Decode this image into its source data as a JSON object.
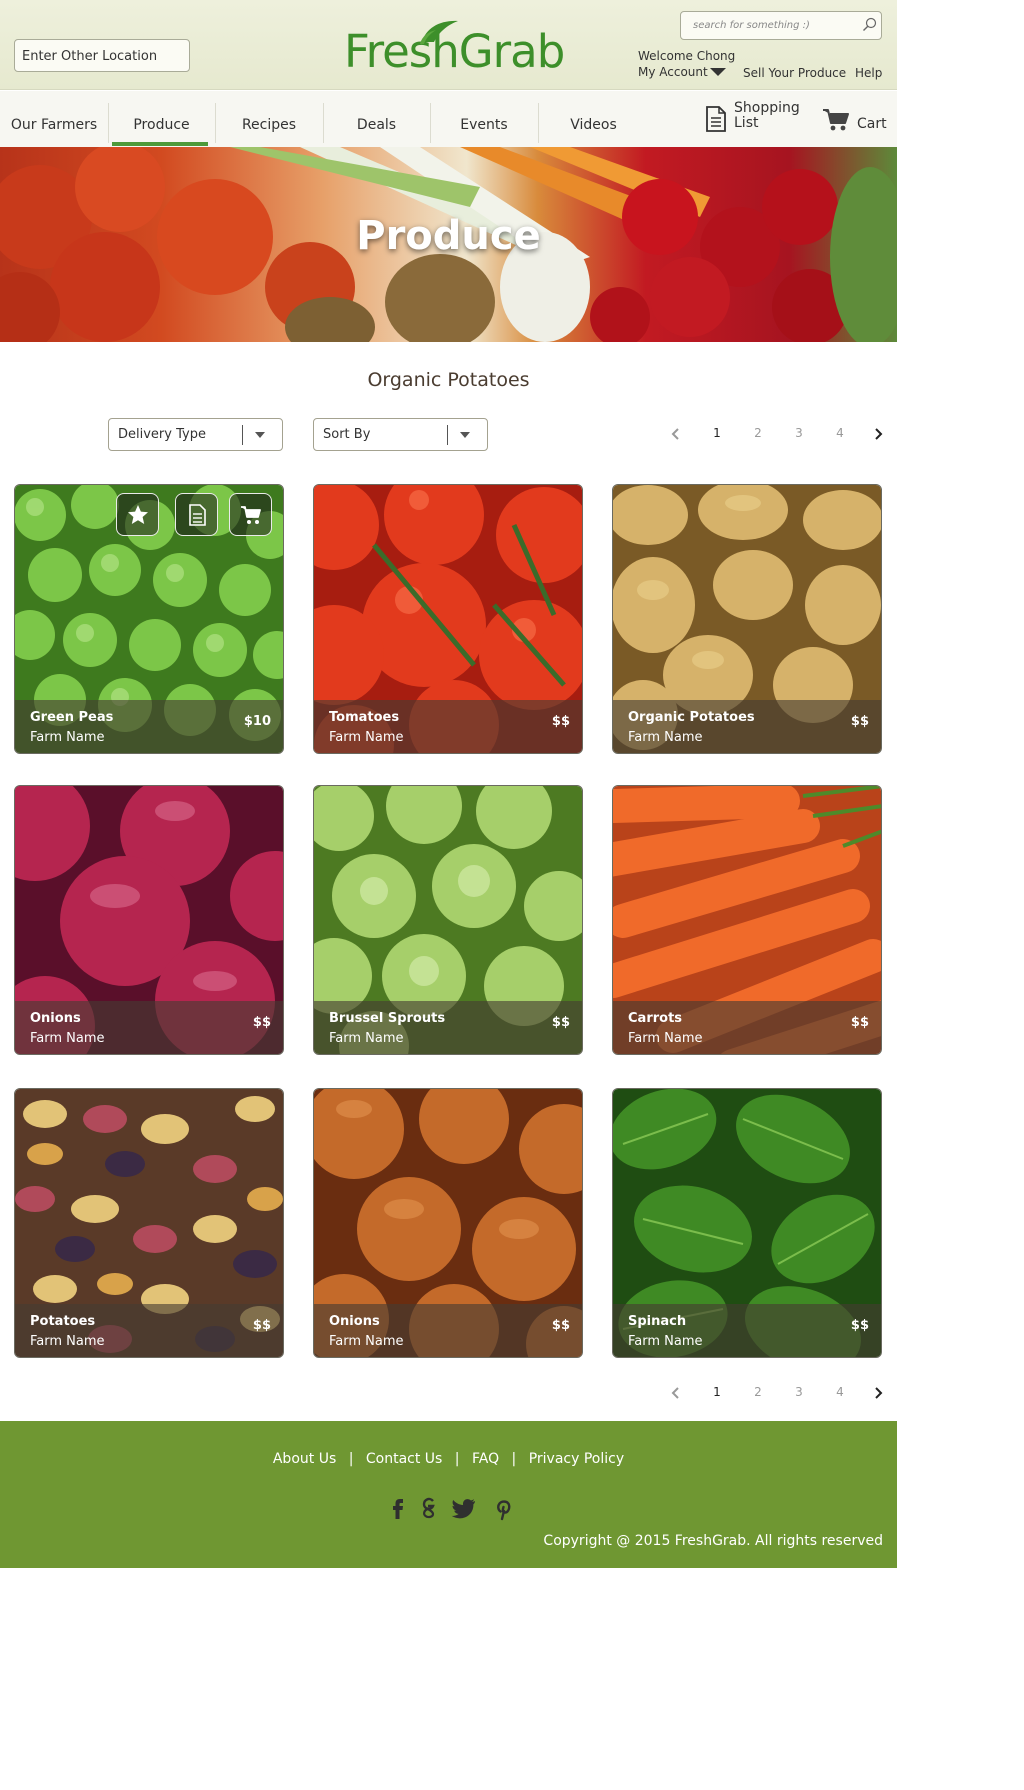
{
  "header": {
    "location_placeholder": "Enter Other Location",
    "logo": "FreshGrab",
    "search_placeholder": "search for something :)",
    "welcome": "Welcome Chong",
    "my_account": "My Account",
    "sell": "Sell Your Produce",
    "help": "Help"
  },
  "nav": {
    "items": [
      "Our Farmers",
      "Produce",
      "Recipes",
      "Deals",
      "Events",
      "Videos"
    ],
    "active": "Produce",
    "shopping_list_line1": "Shopping",
    "shopping_list_line2": "List",
    "cart": "Cart"
  },
  "hero": {
    "title": "Produce"
  },
  "main": {
    "title": "Organic Potatoes",
    "delivery_type": "Delivery Type",
    "sort_by": "Sort By",
    "pages": [
      "1",
      "2",
      "3",
      "4"
    ],
    "current_page": "1"
  },
  "products": [
    {
      "name": "Green Peas",
      "farm": "Farm Name",
      "price": "$10"
    },
    {
      "name": "Tomatoes",
      "farm": "Farm Name",
      "price": "$$"
    },
    {
      "name": "Organic Potatoes",
      "farm": "Farm Name",
      "price": "$$"
    },
    {
      "name": "Onions",
      "farm": "Farm Name",
      "price": "$$"
    },
    {
      "name": "Brussel Sprouts",
      "farm": "Farm Name",
      "price": "$$"
    },
    {
      "name": "Carrots",
      "farm": "Farm Name",
      "price": "$$"
    },
    {
      "name": "Potatoes",
      "farm": "Farm Name",
      "price": "$$"
    },
    {
      "name": "Onions",
      "farm": "Farm Name",
      "price": "$$"
    },
    {
      "name": "Spinach",
      "farm": "Farm Name",
      "price": "$$"
    }
  ],
  "footer": {
    "links": [
      "About Us",
      "Contact Us",
      "FAQ",
      "Privacy Policy"
    ],
    "separator": "|",
    "social": [
      "facebook-icon",
      "google-plus-icon",
      "twitter-icon",
      "pinterest-icon"
    ],
    "copyright": "Copyright @ 2015 FreshGrab. All rights reserved"
  },
  "colors": {
    "brand_green": "#3d8f2a",
    "footer_green": "#6f9732",
    "nav_active": "#4e9a3a"
  }
}
